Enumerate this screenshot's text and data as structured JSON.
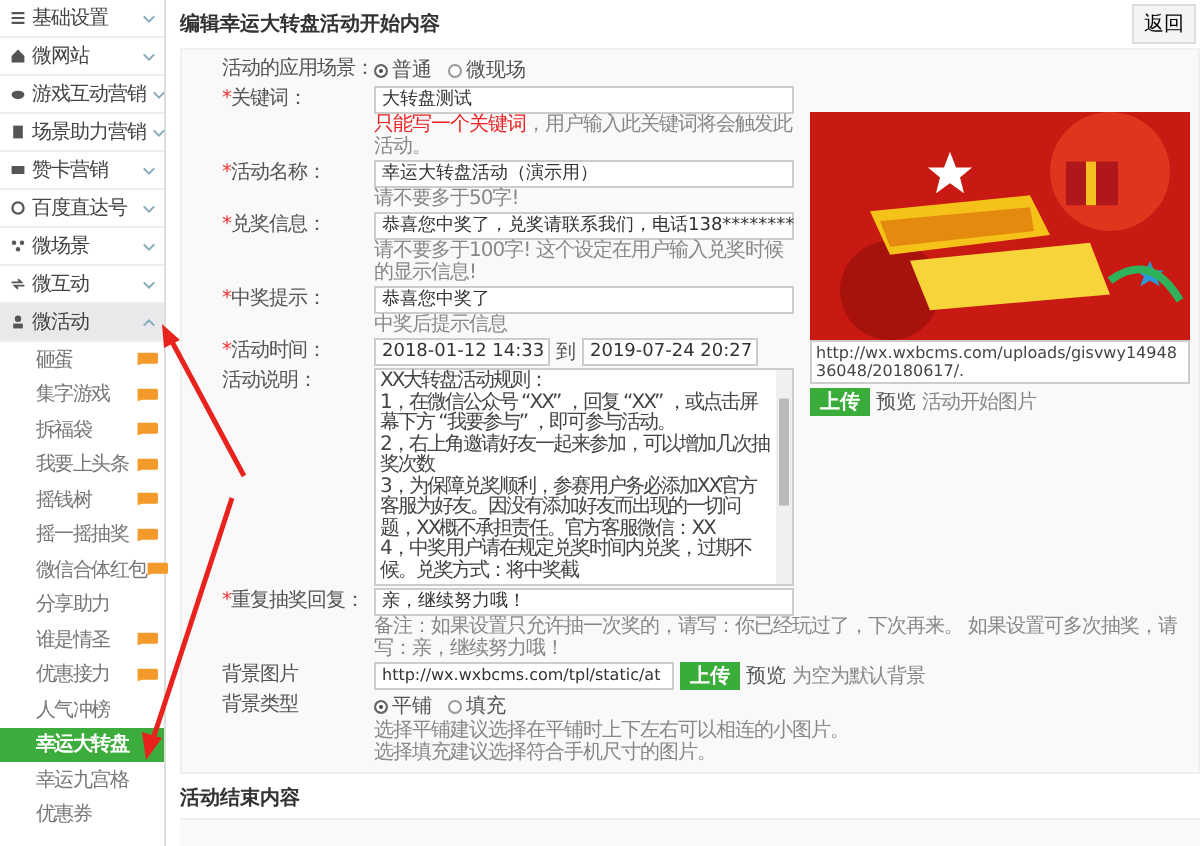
{
  "sidebar": {
    "items": [
      {
        "label": "基础设置",
        "expanded": false
      },
      {
        "label": "微网站",
        "expanded": false
      },
      {
        "label": "游戏互动营销",
        "expanded": false
      },
      {
        "label": "场景助力营销",
        "expanded": false
      },
      {
        "label": "赞卡营销",
        "expanded": false
      },
      {
        "label": "百度直达号",
        "expanded": false
      },
      {
        "label": "微场景",
        "expanded": false
      },
      {
        "label": "微互动",
        "expanded": false
      },
      {
        "label": "微活动",
        "expanded": true,
        "children": [
          {
            "label": "砸蛋",
            "hot": true,
            "selected": false
          },
          {
            "label": "集字游戏",
            "hot": true,
            "selected": false
          },
          {
            "label": "拆福袋",
            "hot": true,
            "selected": false
          },
          {
            "label": "我要上头条",
            "hot": true,
            "selected": false
          },
          {
            "label": "摇钱树",
            "hot": true,
            "selected": false
          },
          {
            "label": "摇一摇抽奖",
            "hot": true,
            "selected": false
          },
          {
            "label": "微信合体红包",
            "hot": true,
            "selected": false
          },
          {
            "label": "分享助力",
            "hot": false,
            "selected": false
          },
          {
            "label": "谁是情圣",
            "hot": true,
            "selected": false
          },
          {
            "label": "优惠接力",
            "hot": true,
            "selected": false
          },
          {
            "label": "人气冲榜",
            "hot": false,
            "selected": false
          },
          {
            "label": "幸运大转盘",
            "hot": false,
            "selected": true
          },
          {
            "label": "幸运九宫格",
            "hot": false,
            "selected": false
          },
          {
            "label": "优惠券",
            "hot": false,
            "selected": false
          }
        ]
      }
    ]
  },
  "main": {
    "title": "编辑幸运大转盘活动开始内容",
    "back_button": "返回",
    "fields": [
      {
        "kind": "radio",
        "label": "活动的应用场景：",
        "options": [
          {
            "label": "普通",
            "selected": true
          },
          {
            "label": "微现场",
            "selected": false
          }
        ]
      },
      {
        "kind": "text",
        "marker": "*",
        "label": "关键词：",
        "value": "大转盘测试",
        "warning": "只能写一个关键词",
        "hint": "，用户输入此关键词将会触发此活动。"
      },
      {
        "kind": "text",
        "marker": "*",
        "label": "活动名称：",
        "value": "幸运大转盘活动（演示用）",
        "hint": "请不要多于50字!"
      },
      {
        "kind": "text",
        "marker": "*",
        "label": "兑奖信息：",
        "value": "恭喜您中奖了，兑奖请联系我们，电话138********",
        "hint": "请不要多于100字! 这个设定在用户输入兑奖时候的显示信息!"
      },
      {
        "kind": "text",
        "marker": "*",
        "label": "中奖提示：",
        "value": "恭喜您中奖了",
        "hint": "中奖后提示信息"
      },
      {
        "kind": "date_range",
        "marker": "*",
        "label": "活动时间：",
        "start": "2018-01-12 14:33",
        "separator": "到",
        "end": "2019-07-24 20:27"
      },
      {
        "kind": "textarea",
        "label": "活动说明：",
        "lines": [
          "XX大转盘活动规则：",
          "1，在微信公众号 “XX” ，回复 “XX” ，或点击屏幕下方 “我要参与” ，即可参与活动。",
          "2，右上角邀请好友一起来参加，可以增加几次抽奖次数",
          "3，为保障兑奖顺利，参赛用户务必添加XX官方客服为好友。因没有添加好友而出现的一切问题，XX概不承担责任。官方客服微信：XX",
          "4，中奖用户请在规定兑奖时间内兑奖，过期不候。兑奖方式：将中奖截"
        ]
      },
      {
        "kind": "text",
        "marker": "*",
        "label": "重复抽奖回复：",
        "value": "亲，继续努力哦！",
        "hint": "备注：如果设置只允许抽一次奖的，请写：你已经玩过了，下次再来。 如果设置可多次抽奖，请写：亲，继续努力哦！"
      },
      {
        "kind": "upload",
        "label": "背景图片",
        "value": "http://wx.wxbcms.com/tpl/static/at",
        "button": "上传",
        "preview": "预览",
        "hint": "为空为默认背景"
      },
      {
        "kind": "radio",
        "label": "背景类型",
        "options": [
          {
            "label": "平铺",
            "selected": true
          },
          {
            "label": "填充",
            "selected": false
          }
        ],
        "notes": [
          "选择平铺建议选择在平铺时上下左右可以相连的小图片。",
          "选择填充建议选择符合手机尺寸的图片。"
        ]
      }
    ],
    "image": {
      "kind": "picture",
      "url": "http://wx.wxbcms.com/uploads/gisvwy1494836048/20180617/.",
      "button": "上传",
      "preview": "预览",
      "hint": "活动开始图片"
    },
    "end_section": {
      "title": "活动结束内容"
    }
  }
}
